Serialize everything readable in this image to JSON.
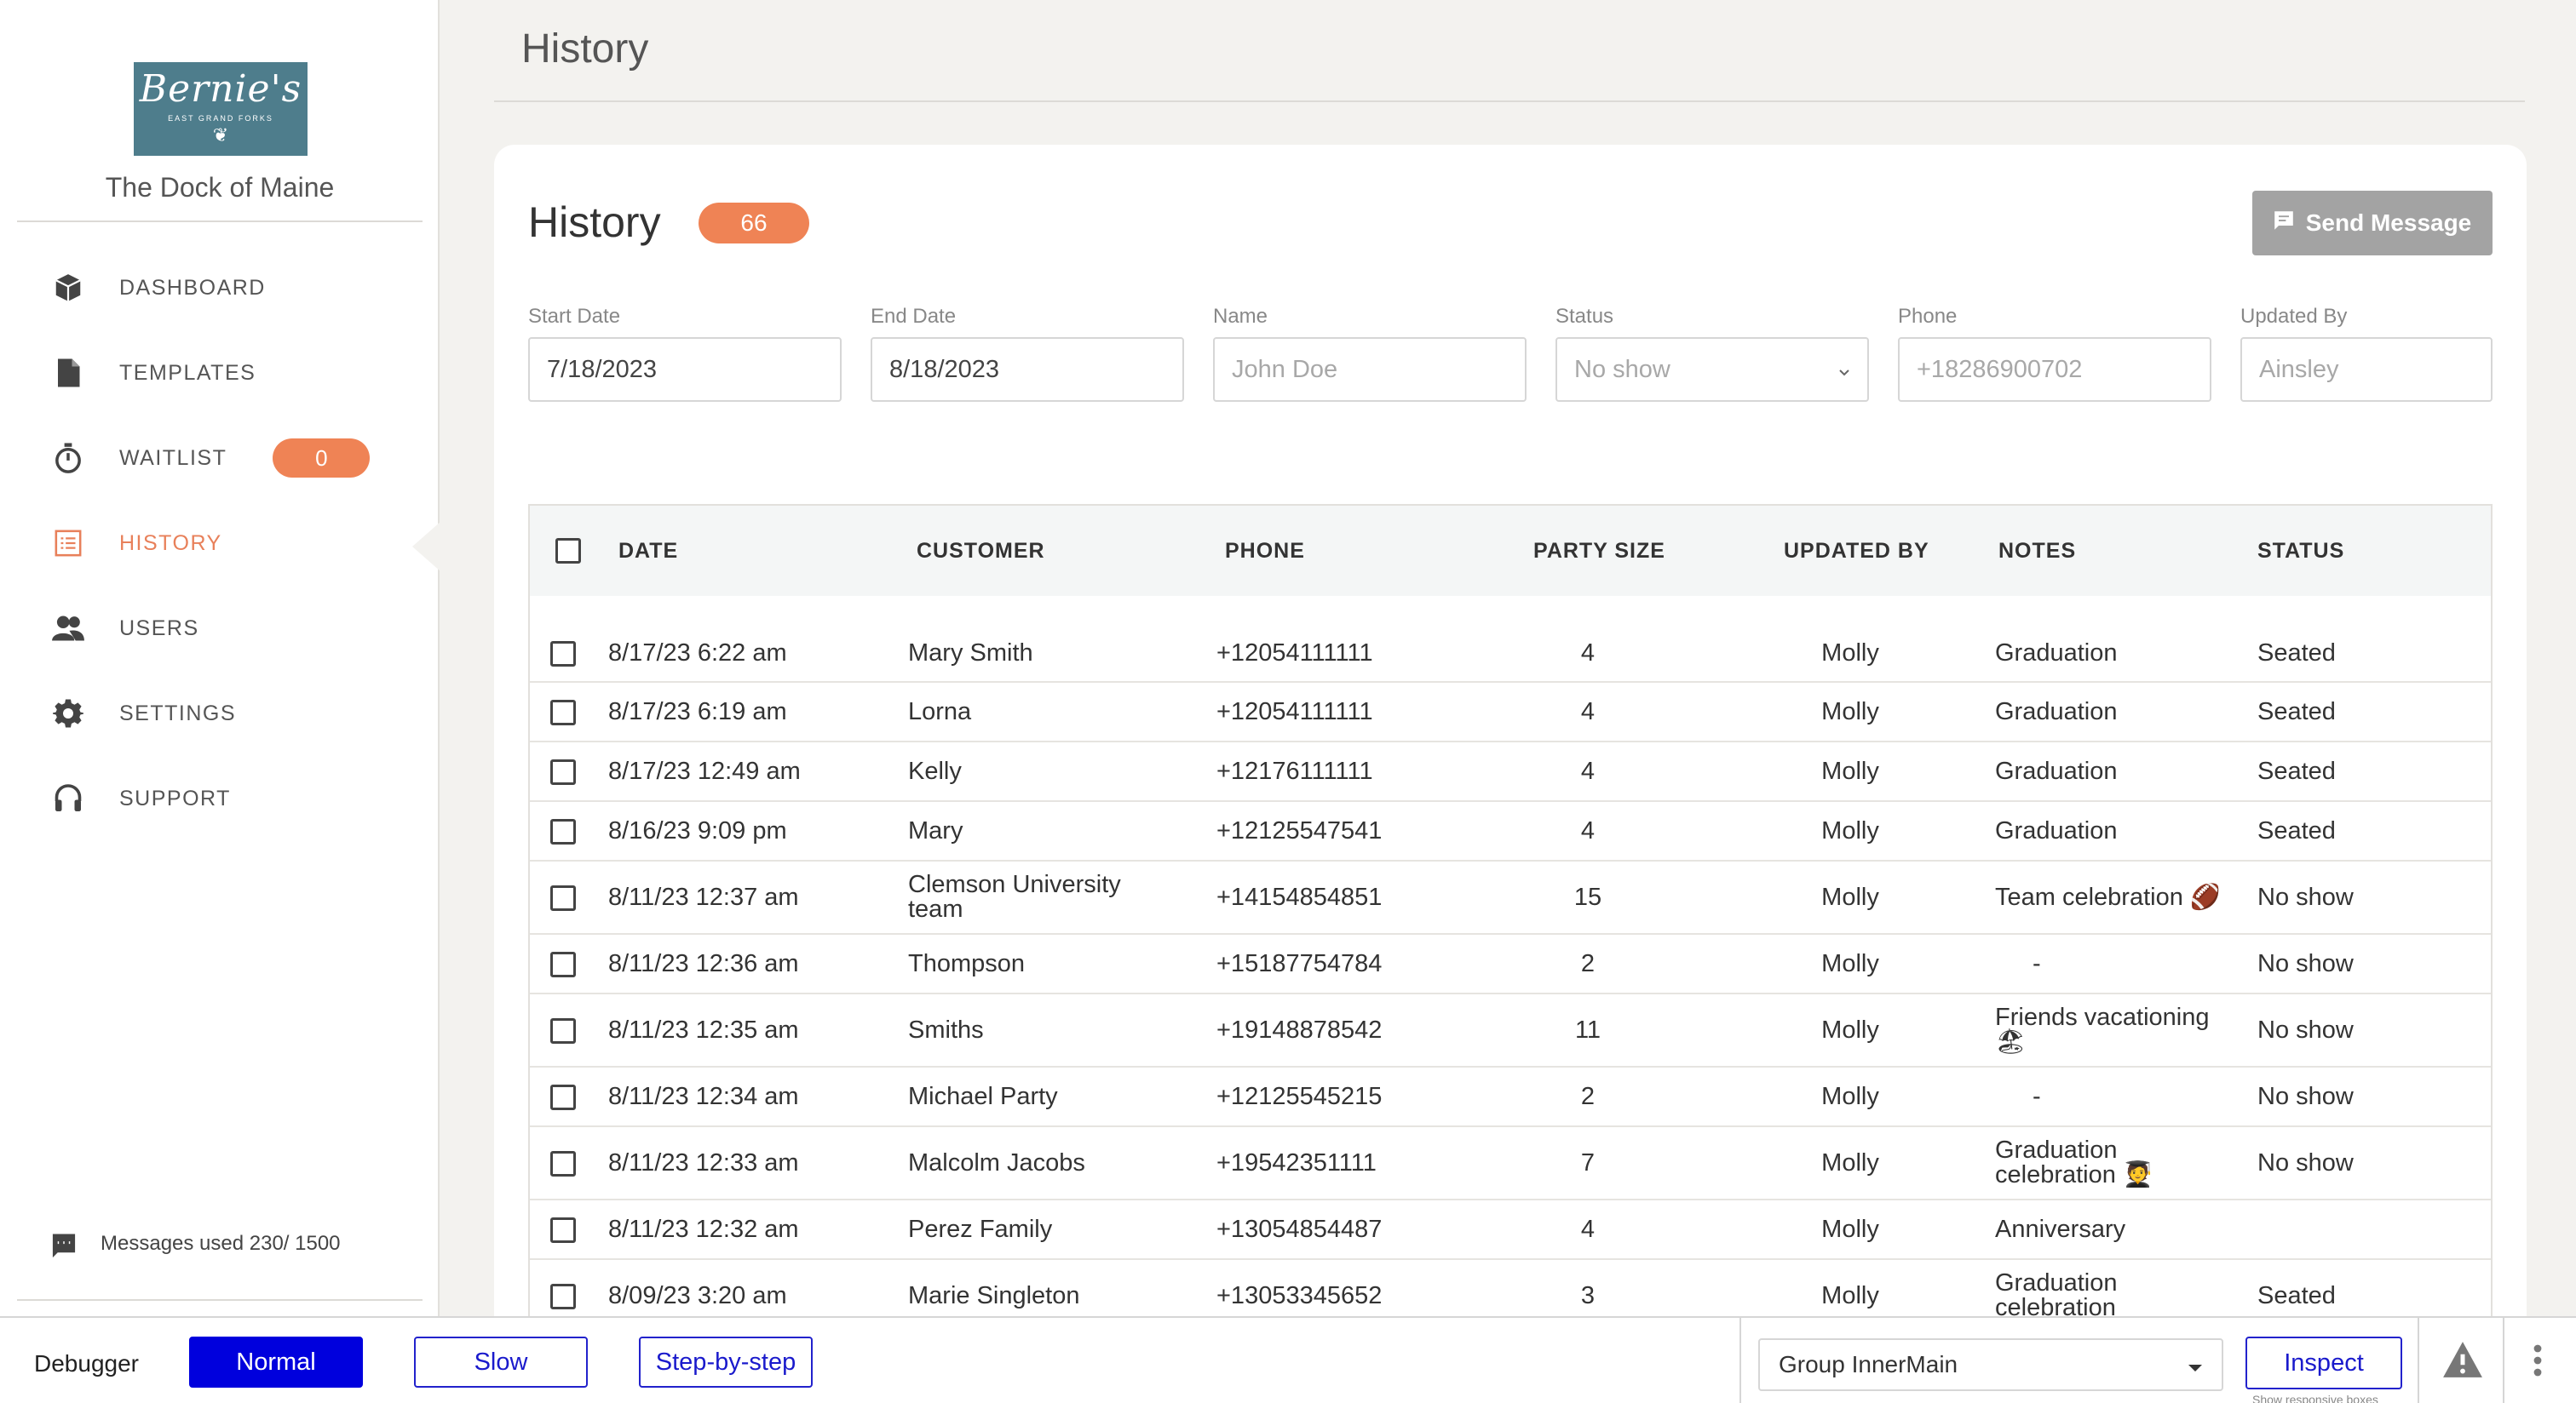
{
  "sidebar": {
    "logo": {
      "script": "Bernie's",
      "tagline": "EAST GRAND FORKS"
    },
    "restaurant_name": "The Dock of Maine",
    "nav": [
      {
        "label": "DASHBOARD",
        "icon": "cube-icon"
      },
      {
        "label": "TEMPLATES",
        "icon": "document-icon"
      },
      {
        "label": "WAITLIST",
        "icon": "stopwatch-icon",
        "badge": "0"
      },
      {
        "label": "HISTORY",
        "icon": "list-icon",
        "active": true
      },
      {
        "label": "USERS",
        "icon": "users-icon"
      },
      {
        "label": "SETTINGS",
        "icon": "gear-icon"
      },
      {
        "label": "SUPPORT",
        "icon": "headset-icon"
      }
    ],
    "messages_used": "Messages used  230/ 1500"
  },
  "page": {
    "title": "History"
  },
  "card": {
    "title": "History",
    "count": "66",
    "send_button": "Send Message",
    "filters": {
      "start_date": {
        "label": "Start Date",
        "value": "7/18/2023"
      },
      "end_date": {
        "label": "End Date",
        "value": "8/18/2023"
      },
      "name": {
        "label": "Name",
        "placeholder": "John Doe"
      },
      "status": {
        "label": "Status",
        "value": "No show"
      },
      "phone": {
        "label": "Phone",
        "placeholder": "+18286900702"
      },
      "updated_by": {
        "label": "Updated By",
        "placeholder": "Ainsley"
      }
    }
  },
  "table": {
    "headers": {
      "date": "DATE",
      "customer": "CUSTOMER",
      "phone": "PHONE",
      "party_size": "PARTY SIZE",
      "updated_by": "UPDATED BY",
      "notes": "NOTES",
      "status": "STATUS"
    },
    "rows": [
      {
        "date": "8/17/23 6:22 am",
        "customer": "Mary Smith",
        "phone": "+12054111111",
        "party_size": "4",
        "updated_by": "Molly",
        "notes": "Graduation",
        "status": "Seated"
      },
      {
        "date": "8/17/23 6:19 am",
        "customer": "Lorna",
        "phone": "+12054111111",
        "party_size": "4",
        "updated_by": "Molly",
        "notes": "Graduation",
        "status": "Seated"
      },
      {
        "date": "8/17/23 12:49 am",
        "customer": "Kelly",
        "phone": "+12176111111",
        "party_size": "4",
        "updated_by": "Molly",
        "notes": "Graduation",
        "status": "Seated"
      },
      {
        "date": "8/16/23 9:09 pm",
        "customer": "Mary",
        "phone": "+12125547541",
        "party_size": "4",
        "updated_by": "Molly",
        "notes": "Graduation",
        "status": "Seated"
      },
      {
        "date": "8/11/23 12:37 am",
        "customer": "Clemson University team",
        "phone": "+14154854851",
        "party_size": "15",
        "updated_by": "Molly",
        "notes": "Team celebration 🏈",
        "status": "No show"
      },
      {
        "date": "8/11/23 12:36 am",
        "customer": "Thompson",
        "phone": "+15187754784",
        "party_size": "2",
        "updated_by": "Molly",
        "notes": "-",
        "status": "No show"
      },
      {
        "date": "8/11/23 12:35 am",
        "customer": "Smiths",
        "phone": "+19148878542",
        "party_size": "11",
        "updated_by": "Molly",
        "notes": "Friends vacationing 🏖",
        "status": "No show"
      },
      {
        "date": "8/11/23 12:34 am",
        "customer": "Michael Party",
        "phone": "+12125545215",
        "party_size": "2",
        "updated_by": "Molly",
        "notes": "-",
        "status": "No show"
      },
      {
        "date": "8/11/23 12:33 am",
        "customer": "Malcolm Jacobs",
        "phone": "+19542351111",
        "party_size": "7",
        "updated_by": "Molly",
        "notes": "Graduation celebration 🧑‍🎓",
        "status": "No show"
      },
      {
        "date": "8/11/23 12:32 am",
        "customer": "Perez Family",
        "phone": "+13054854487",
        "party_size": "4",
        "updated_by": "Molly",
        "notes": "Anniversary",
        "status": ""
      },
      {
        "date": "8/09/23 3:20 am",
        "customer": "Marie Singleton",
        "phone": "+13053345652",
        "party_size": "3",
        "updated_by": "Molly",
        "notes": "Graduation celebration",
        "status": "Seated"
      }
    ]
  },
  "debugger": {
    "label": "Debugger",
    "modes": [
      "Normal",
      "Slow",
      "Step-by-step"
    ],
    "active_mode": "Normal",
    "group_select": "Group InnerMain",
    "inspect": "Inspect",
    "inspect_sub": "Show responsive boxes"
  },
  "colors": {
    "accent": "#ef8355",
    "logo_bg": "#4e7d8c",
    "debug_blue": "#0000dd"
  }
}
